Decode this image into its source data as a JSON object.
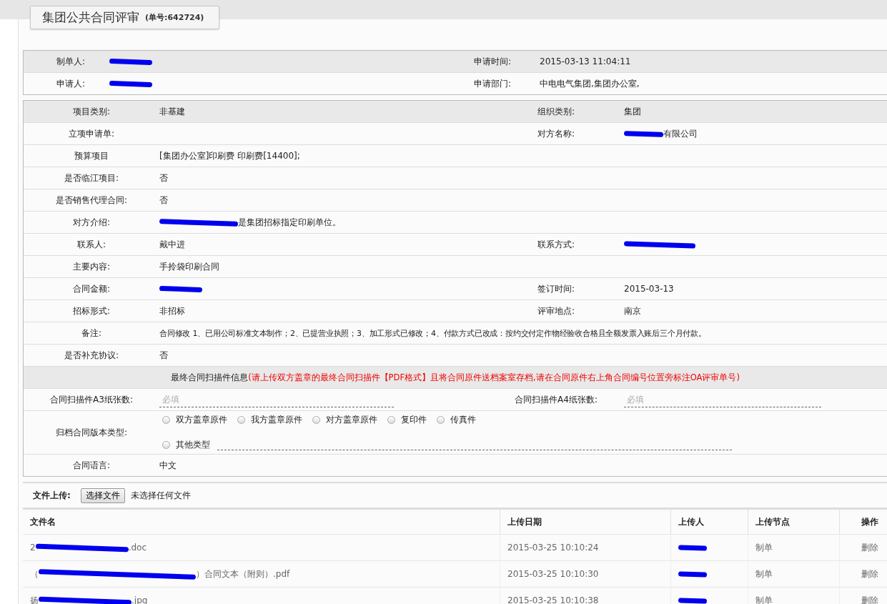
{
  "title": {
    "main": "集团公共合同评审",
    "number": "(单号:642724)"
  },
  "header_rows": [
    {
      "label": "制单人:",
      "value": {
        "redacted": true
      },
      "label2": "申请时间:",
      "value2": "2015-03-13 11:04:11"
    },
    {
      "label": "申请人:",
      "value": {
        "redacted": true
      },
      "label2": "申请部门:",
      "value2": "中电电气集团,集团办公室,"
    }
  ],
  "detail_rows": [
    {
      "label": "项目类别:",
      "value": "非基建",
      "label2": "组织类别:",
      "value2": "集团"
    },
    {
      "label": "立项申请单:",
      "label2": "对方名称:",
      "value2": {
        "redacted": true,
        "after": "有限公司"
      }
    },
    {
      "label": "预算项目",
      "value": "[集团办公室]印刷费 印刷费[14400];"
    },
    {
      "label": "是否临江项目:",
      "value": "否"
    },
    {
      "label": "是否销售代理合同:",
      "value": "否"
    },
    {
      "label": "对方介绍:",
      "value": {
        "redacted": true,
        "after": "是集团招标指定印刷单位。"
      }
    },
    {
      "label": "联系人:",
      "value": "戴中进",
      "label2": "联系方式:",
      "value2": {
        "redacted": true
      }
    },
    {
      "label": "主要内容:",
      "value": "手拎袋印刷合同"
    },
    {
      "label": "合同金额:",
      "value": {
        "redacted": true
      },
      "label2": "签订时间:",
      "value2": "2015-03-13"
    },
    {
      "label": "招标形式:",
      "value": "非招标",
      "label2": "评审地点:",
      "value2": "南京"
    },
    {
      "label": "备注:",
      "value": "合同修改 1、已用公司标准文本制作；2、已提营业执照；3、加工形式已修改；4、付款方式已改成：按约交付定作物经验收合格且全额发票入账后三个月付款。"
    },
    {
      "label": "是否补充协议:",
      "value": "否"
    }
  ],
  "scan_section": {
    "title": "最终合同扫描件信息",
    "note": "(请上传双方盖章的最终合同扫描件【PDF格式】且将合同原件送档案室存档,请在合同原件右上角合同编号位置旁标注OA评审单号)"
  },
  "scan_counts": [
    {
      "label": "合同扫描件A3纸张数:",
      "placeholder": "必填"
    },
    {
      "label": "合同扫描件A4纸张数:",
      "placeholder": "必填"
    }
  ],
  "version_type": {
    "label": "归档合同版本类型:",
    "options": [
      {
        "label": "双方盖章原件",
        "selected": false
      },
      {
        "label": "我方盖章原件",
        "selected": false
      },
      {
        "label": "对方盖章原件",
        "selected": false
      },
      {
        "label": "复印件",
        "selected": false
      },
      {
        "label": "传真件",
        "selected": false
      },
      {
        "label": "其他类型",
        "selected": false
      }
    ]
  },
  "language": {
    "label": "合同语言:",
    "value": "中文"
  },
  "upload": {
    "label": "文件上传:",
    "button": "选择文件",
    "status": "未选择任何文件"
  },
  "files": {
    "columns": [
      "文件名",
      "上传日期",
      "上传人",
      "上传节点",
      "操作"
    ],
    "rows": [
      {
        "name": {
          "before": "2",
          "redacted": true,
          "after": ".doc"
        },
        "date": "2015-03-25 10:10:24",
        "uploader": {
          "redacted": true
        },
        "node": "制单",
        "action": "删除"
      },
      {
        "name": {
          "before": "（",
          "redacted": true,
          "after": "）合同文本（附则）.pdf"
        },
        "date": "2015-03-25 10:10:30",
        "uploader": {
          "redacted": true
        },
        "node": "制单",
        "action": "删除"
      },
      {
        "name": {
          "before": "扬",
          "redacted": true,
          "after": ".jpg"
        },
        "date": "2015-03-25 10:10:38",
        "uploader": {
          "redacted": true
        },
        "node": "制单",
        "action": "删除"
      }
    ]
  }
}
